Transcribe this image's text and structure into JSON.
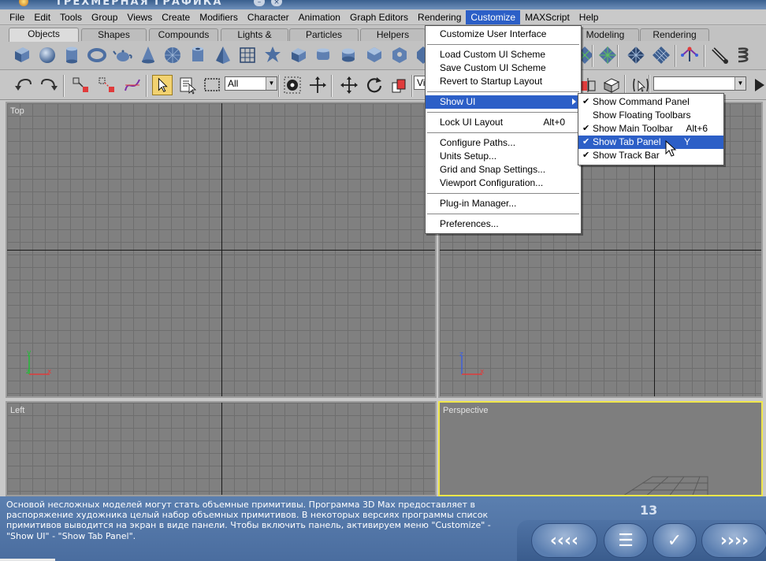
{
  "app_title": "ТРЕХМЕРНАЯ ГРАФИКА",
  "menubar": [
    "File",
    "Edit",
    "Tools",
    "Group",
    "Views",
    "Create",
    "Modifiers",
    "Character",
    "Animation",
    "Graph Editors",
    "Rendering",
    "Customize",
    "MAXScript",
    "Help"
  ],
  "active_menu": "Customize",
  "tabs": [
    "Objects",
    "Shapes",
    "Compounds",
    "Lights & Cameras",
    "Particles",
    "Helpers",
    "Modeling",
    "Rendering"
  ],
  "active_tab": "Objects",
  "toolbar2": {
    "filter_value": "All",
    "view_value": "Vie"
  },
  "viewports": {
    "top": "Top",
    "left": "Left",
    "perspective": "Perspective"
  },
  "customize_menu": {
    "items": [
      {
        "label": "Customize User Interface"
      },
      {
        "separator": true
      },
      {
        "label": "Load Custom UI Scheme"
      },
      {
        "label": "Save Custom UI Scheme"
      },
      {
        "label": "Revert to Startup Layout"
      },
      {
        "separator": true
      },
      {
        "label": "Show UI",
        "highlighted": true,
        "submenu": true
      },
      {
        "separator": true
      },
      {
        "label": "Lock UI Layout",
        "shortcut": "Alt+0"
      },
      {
        "separator": true
      },
      {
        "label": "Configure Paths..."
      },
      {
        "label": "Units Setup..."
      },
      {
        "label": "Grid and Snap Settings..."
      },
      {
        "label": "Viewport Configuration..."
      },
      {
        "separator": true
      },
      {
        "label": "Plug-in Manager..."
      },
      {
        "separator": true
      },
      {
        "label": "Preferences..."
      }
    ]
  },
  "show_ui_submenu": {
    "items": [
      {
        "label": "Show Command Panel",
        "checked": true
      },
      {
        "label": "Show Floating Toolbars",
        "checked": false
      },
      {
        "label": "Show Main Toolbar",
        "checked": true,
        "shortcut": "Alt+6"
      },
      {
        "label": "Show Tab Panel",
        "checked": true,
        "shortcut": "Y",
        "highlighted": true
      },
      {
        "label": "Show Track Bar",
        "checked": true
      }
    ]
  },
  "info": {
    "lines": [
      "Основой несложных моделей могут стать объемные примитивы. Программа 3D Max предоставляет в",
      "распоряжение художника целый набор объемных примитивов. В некоторых версиях программы список",
      "примитивов выводится на экран в виде панели. Чтобы включить панель, активируем меню \"Customize\" -",
      "\"Show UI\" - \"Show Tab Panel\"."
    ],
    "page_number": "13"
  },
  "nav_buttons": [
    {
      "name": "back",
      "glyph": "‹‹‹‹"
    },
    {
      "name": "contents",
      "glyph": "☰"
    },
    {
      "name": "check",
      "glyph": "✓"
    },
    {
      "name": "forward",
      "glyph": "››››"
    }
  ],
  "colors": {
    "menu_highlight": "#2c5fc7",
    "info_panel": "#5b7faf",
    "viewport_active_border": "#f1e74a"
  },
  "axis_labels": {
    "x": "x",
    "y": "y",
    "z": "z"
  }
}
